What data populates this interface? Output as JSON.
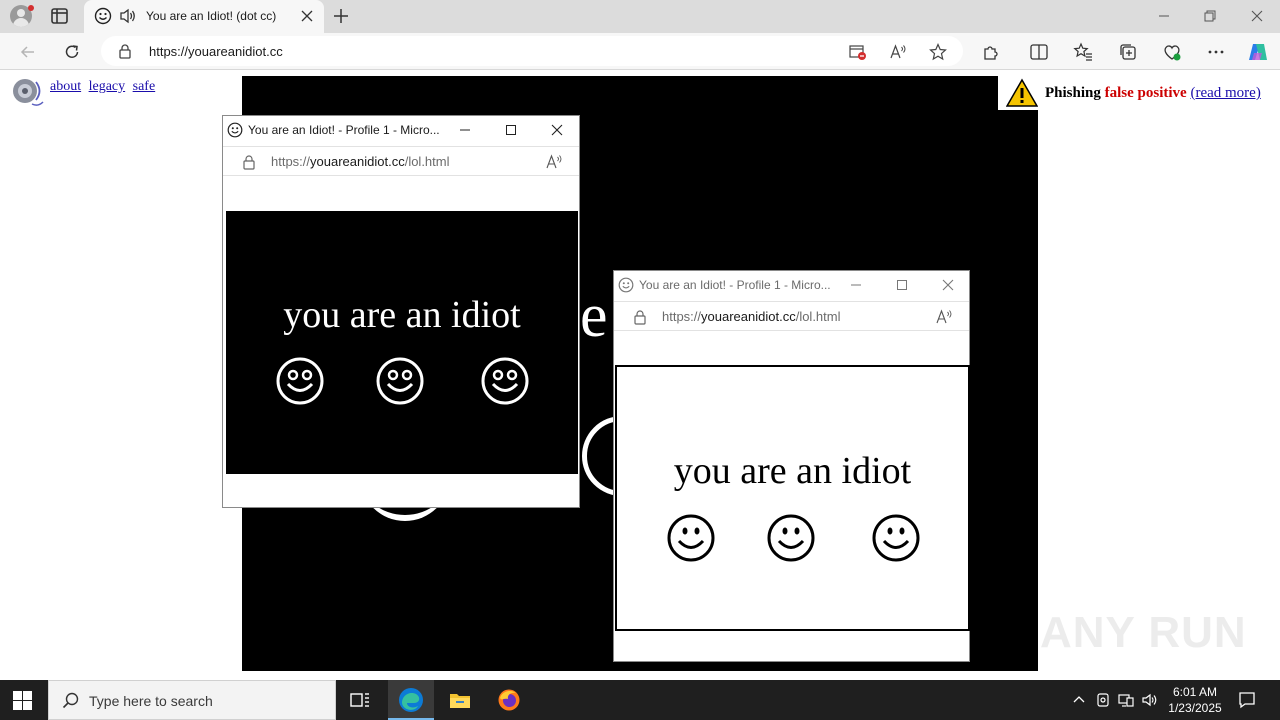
{
  "browser": {
    "tab": {
      "title": "You are an Idiot! (dot cc)"
    },
    "address": {
      "url": "https://youareanidiot.cc"
    }
  },
  "page": {
    "links": [
      "about",
      "legacy",
      "safe"
    ],
    "phishing_banner": {
      "label": "Phishing",
      "status": "false positive",
      "read_more": "(read more)"
    },
    "bg_partial_text": "e"
  },
  "popups": [
    {
      "title": "You are an Idiot! - Profile 1 - Micro...",
      "url_prefix": "https://",
      "url_host": "youareanidiot.cc",
      "url_path": "/lol.html",
      "message": "you are an idiot",
      "theme": "black"
    },
    {
      "title": "You are an Idiot! - Profile 1 - Micro...",
      "url_prefix": "https://",
      "url_host": "youareanidiot.cc",
      "url_path": "/lol.html",
      "message": "you are an idiot",
      "theme": "white"
    }
  ],
  "taskbar": {
    "search_placeholder": "Type here to search",
    "time": "6:01 AM",
    "date": "1/23/2025"
  },
  "watermark": "ANY RUN"
}
